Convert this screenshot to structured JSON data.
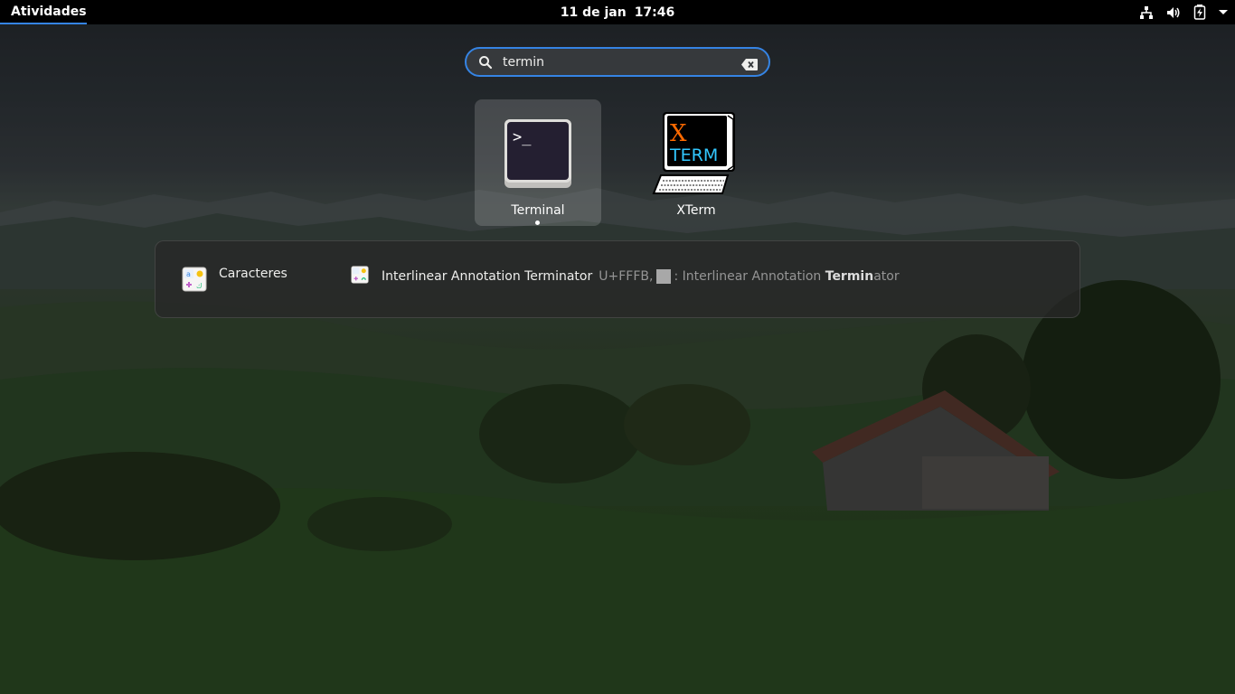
{
  "topbar": {
    "activities": "Atividades",
    "date": "11 de jan",
    "time": "17:46",
    "tray_icons": [
      "network-wired-icon",
      "volume-icon",
      "battery-charging-icon",
      "system-menu-chevron-icon"
    ]
  },
  "search": {
    "value": "termin",
    "icon": "search-icon",
    "clear_icon": "clear-text-icon"
  },
  "apps": [
    {
      "label": "Terminal",
      "icon": "terminal-icon",
      "selected": true,
      "running": true
    },
    {
      "label": "XTerm",
      "icon": "xterm-icon",
      "selected": false,
      "running": false
    }
  ],
  "xterm_icon_text": {
    "x": "X",
    "term": "TERM"
  },
  "terminal_icon_prompt": ">_",
  "provider": {
    "name": "Caracteres",
    "icon": "characters-app-icon",
    "result": {
      "title": "Interlinear Annotation Terminator",
      "desc_prefix": "U+FFFB,",
      "desc_text": ": Interlinear Annotation ",
      "desc_match": "Termin",
      "desc_rest": "ator"
    }
  },
  "colors": {
    "accent": "#3584e4",
    "topbar": "#000000",
    "xterm_x": "#ff6a00",
    "xterm_term": [
      "#ffc800",
      "#64e664",
      "#32c8ff",
      "#50a0ff"
    ]
  }
}
